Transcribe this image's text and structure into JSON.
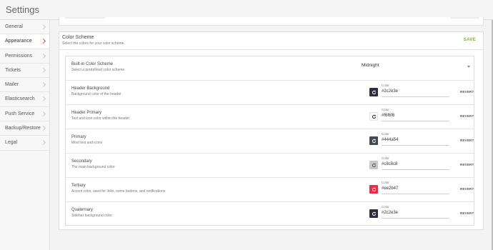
{
  "app": {
    "title": "Settings"
  },
  "sidebar": {
    "items": [
      {
        "label": "General"
      },
      {
        "label": "Appearance",
        "active": true
      },
      {
        "label": "Permissions"
      },
      {
        "label": "Tickets"
      },
      {
        "label": "Mailer"
      },
      {
        "label": "Elasticsearch"
      },
      {
        "label": "Push Service"
      },
      {
        "label": "Backup/Restore"
      },
      {
        "label": "Legal"
      }
    ]
  },
  "color_scheme": {
    "title": "Color Scheme",
    "subtitle": "Select the colors for your color scheme.",
    "save_label": "SAVE",
    "builtin": {
      "title": "Built-in Color Scheme",
      "description": "Select a predefined color scheme",
      "value": "Midnight"
    },
    "colors": [
      {
        "title": "Header Background",
        "description": "Background color of the header",
        "field_label": "Color",
        "value": "#2c2e3e",
        "swatch": "#2c2e3e",
        "icon_color": "#ffffff",
        "revert_label": "REVERT"
      },
      {
        "title": "Header Primary",
        "description": "Text and icon color within the header",
        "field_label": "Color",
        "value": "#f6f6f6",
        "swatch": "#f6f6f6",
        "icon_color": "#2c2e3e",
        "revert_label": "REVERT"
      },
      {
        "title": "Primary",
        "description": "Most text and icons",
        "field_label": "Color",
        "value": "#444a54",
        "swatch": "#444a54",
        "icon_color": "#ffffff",
        "revert_label": "REVERT"
      },
      {
        "title": "Secondary",
        "description": "The main background color",
        "field_label": "Color",
        "value": "#c8c8c8",
        "swatch": "#c8c8c8",
        "icon_color": "#555555",
        "revert_label": "REVERT"
      },
      {
        "title": "Tertiary",
        "description": "Accent color, used for links, some buttons, and notifications",
        "field_label": "Color",
        "value": "#ee2b47",
        "swatch": "#ee2b47",
        "icon_color": "#ffffff",
        "revert_label": "REVERT"
      },
      {
        "title": "Quaternary",
        "description": "Sidebar background color",
        "field_label": "Color",
        "value": "#2c2e3e",
        "swatch": "#2c2e3e",
        "icon_color": "#ffffff",
        "revert_label": "REVERT"
      }
    ],
    "refresh_icon": "refresh-icon"
  },
  "colors": {
    "accent": "#7cab3a",
    "active_chevron": "#e04848"
  }
}
